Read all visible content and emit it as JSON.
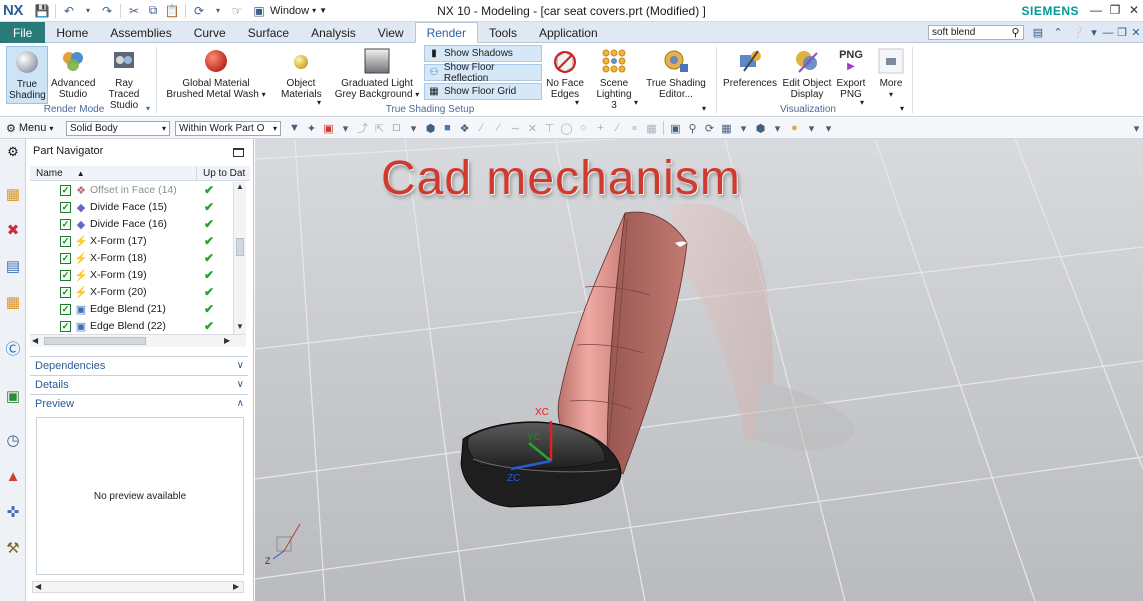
{
  "app": {
    "logo": "NX",
    "title": "NX 10 - Modeling - [car seat covers.prt (Modified) ]",
    "brand": "SIEMENS",
    "window_menu": "Window"
  },
  "tabs": [
    {
      "label": "File"
    },
    {
      "label": "Home"
    },
    {
      "label": "Assemblies"
    },
    {
      "label": "Curve"
    },
    {
      "label": "Surface"
    },
    {
      "label": "Analysis"
    },
    {
      "label": "View"
    },
    {
      "label": "Render"
    },
    {
      "label": "Tools"
    },
    {
      "label": "Application"
    }
  ],
  "search": {
    "value": "soft blend"
  },
  "ribbon": {
    "true_shading": "True Shading",
    "advanced_studio": "Advanced Studio",
    "ray_traced_studio": "Ray Traced Studio",
    "render_mode_group": "Render Mode",
    "global_material": "Global Material",
    "global_material_value": "Brushed Metal Wash",
    "object_materials": "Object Materials",
    "graduated_light": "Graduated Light",
    "graduated_light_value": "Grey Background",
    "show_shadows": "Show Shadows",
    "show_floor_reflection": "Show Floor Reflection",
    "show_floor_grid": "Show Floor Grid",
    "no_face_edges": "No Face Edges",
    "scene_lighting": "Scene Lighting 3",
    "true_shading_editor": "True Shading Editor...",
    "true_shading_setup_group": "True Shading Setup",
    "preferences": "Preferences",
    "edit_object_display": "Edit Object Display",
    "export_png": "Export PNG",
    "png_badge": "PNG",
    "more": "More",
    "visualization_group": "Visualization"
  },
  "toolbar": {
    "menu": "Menu",
    "filter": "Solid Body",
    "scope": "Within Work Part O"
  },
  "navigator": {
    "title": "Part Navigator",
    "col_name": "Name",
    "col_uptodate": "Up to Dat",
    "rows": [
      {
        "label": "Offset in Face (14)",
        "grey": true
      },
      {
        "label": "Divide Face (15)"
      },
      {
        "label": "Divide Face (16)"
      },
      {
        "label": "X-Form (17)"
      },
      {
        "label": "X-Form (18)"
      },
      {
        "label": "X-Form (19)"
      },
      {
        "label": "X-Form (20)"
      },
      {
        "label": "Edge Blend (21)"
      },
      {
        "label": "Edge Blend (22)"
      }
    ],
    "dependencies": "Dependencies",
    "details": "Details",
    "preview": "Preview",
    "no_preview": "No preview available"
  },
  "graphics": {
    "overlay_title": "Cad mechanism",
    "axis_xc": "XC",
    "axis_yc": "YC",
    "axis_zc": "ZC",
    "triad_z": "Z"
  },
  "colors": {
    "accent": "#2b5fa5",
    "file_tab": "#2a7a7a",
    "brand": "#009999",
    "seat_back": "#d9968f",
    "seat_cushion": "#2b2b2b",
    "overlay": "#d0392d"
  }
}
